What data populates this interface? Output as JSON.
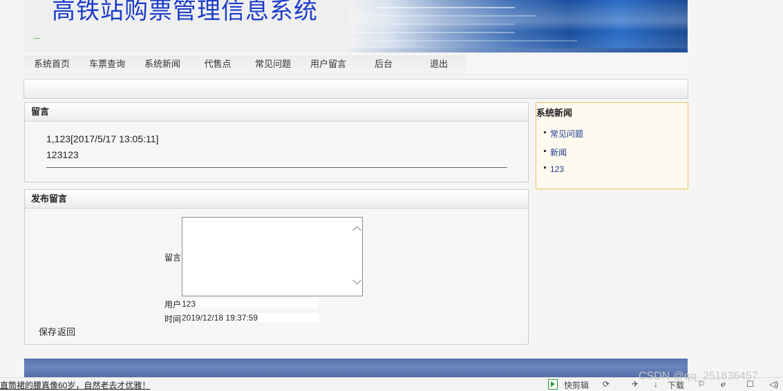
{
  "header": {
    "site_title": "高铁站购票管理信息系统"
  },
  "nav": {
    "items": [
      "系统首页",
      "车票查询",
      "系统新闻",
      "代售点",
      "常见问题",
      "用户留言",
      "后台",
      "退出"
    ]
  },
  "messages_panel": {
    "title": "留言",
    "entry": {
      "header": "1,123[2017/5/17 13:05:11]",
      "body": "123123"
    }
  },
  "post_panel": {
    "title": "发布留言",
    "message_label": "留言",
    "message_value": "",
    "user_label": "用户",
    "user_value": "123",
    "time_label": "时间",
    "time_value": "2019/12/18 19:37:59",
    "save_label": "保存",
    "back_label": "返回"
  },
  "news": {
    "title": "系统新闻",
    "items": [
      "常见问题",
      "新闻",
      "123"
    ]
  },
  "browser_status": {
    "link_text": "直筒裙的腰真像60岁，自然老去才优雅！",
    "kuaijian_label": "快剪辑",
    "download_label": "下载",
    "watermark": "CSDN @qq_251836457"
  },
  "colors": {
    "title_blue": "#1b3cc9",
    "footer_blue": "#5873ad",
    "news_border": "#f0c060",
    "news_bg": "#fffaf0"
  }
}
